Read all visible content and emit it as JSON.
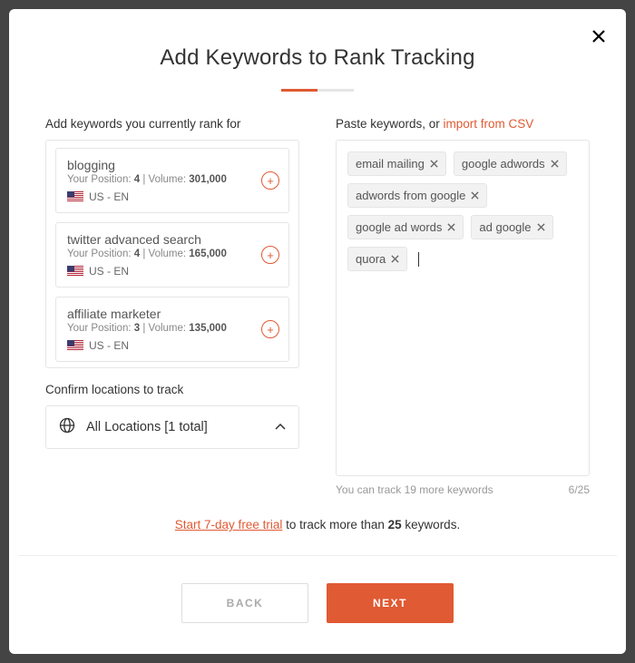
{
  "title": "Add Keywords to Rank Tracking",
  "left": {
    "label": "Add keywords you currently rank for",
    "items": [
      {
        "name": "blogging",
        "position": "4",
        "volume": "301,000",
        "locale": "US - EN"
      },
      {
        "name": "twitter advanced search",
        "position": "4",
        "volume": "165,000",
        "locale": "US - EN"
      },
      {
        "name": "affiliate marketer",
        "position": "3",
        "volume": "135,000",
        "locale": "US - EN"
      }
    ],
    "meta_prefix_pos": "Your Position: ",
    "meta_sep": " | ",
    "meta_prefix_vol": "Volume: ",
    "confirm_label": "Confirm locations to track",
    "location_text": "All Locations [1 total]"
  },
  "right": {
    "label_prefix": "Paste keywords, or ",
    "label_link": "import from CSV",
    "tags": [
      "email mailing",
      "google adwords",
      "adwords from google",
      "google ad words",
      "ad google",
      "quora"
    ],
    "hint": "You can track 19 more keywords",
    "count": "6/25"
  },
  "trial": {
    "link": "Start 7-day free trial",
    "mid": " to track more than ",
    "bold": "25",
    "suffix": " keywords."
  },
  "buttons": {
    "back": "Back",
    "next": "Next"
  }
}
